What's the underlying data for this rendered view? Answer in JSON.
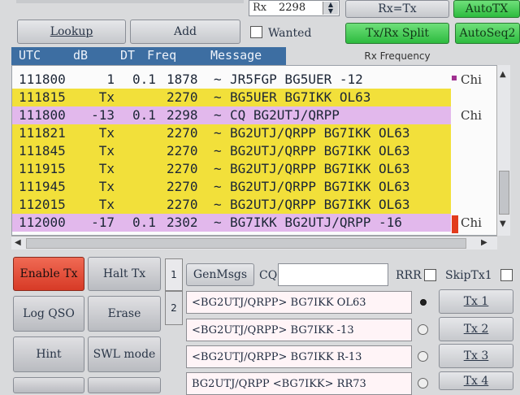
{
  "top": {
    "rx_label": "Rx",
    "rx_value": "2298",
    "rx_eq_tx_label": "Rx=Tx",
    "auto_tx_label": "AutoTX",
    "lookup_label": "Lookup",
    "add_label": "Add",
    "wanted_label": "Wanted",
    "txrx_split_label": "Tx/Rx Split",
    "auto_seq_label": "AutoSeq2"
  },
  "table": {
    "headers": {
      "utc": "UTC",
      "db": "dB",
      "dt": "DT",
      "freq": "Freq",
      "message": "Message"
    },
    "rx_frequency_label": "Rx Frequency",
    "rows": [
      {
        "utc": "111800",
        "db": "1",
        "dt": "0.1",
        "freq": "1878",
        "sep": "~",
        "msg": "JR5FGP BG5UER -12",
        "style": "plain",
        "side": "Chi"
      },
      {
        "utc": "111815",
        "db": "Tx",
        "dt": "",
        "freq": "2270",
        "sep": "~",
        "msg": "BG5UER BG7IKK OL63",
        "style": "yellow",
        "side": ""
      },
      {
        "utc": "111800",
        "db": "-13",
        "dt": "0.1",
        "freq": "2298",
        "sep": "~",
        "msg": "CQ BG2UTJ/QRPP",
        "style": "purple",
        "side": "Chi"
      },
      {
        "utc": "111821",
        "db": "Tx",
        "dt": "",
        "freq": "2270",
        "sep": "~",
        "msg": "BG2UTJ/QRPP BG7IKK OL63",
        "style": "yellow",
        "side": ""
      },
      {
        "utc": "111845",
        "db": "Tx",
        "dt": "",
        "freq": "2270",
        "sep": "~",
        "msg": "BG2UTJ/QRPP BG7IKK OL63",
        "style": "yellow",
        "side": ""
      },
      {
        "utc": "111915",
        "db": "Tx",
        "dt": "",
        "freq": "2270",
        "sep": "~",
        "msg": "BG2UTJ/QRPP BG7IKK OL63",
        "style": "yellow",
        "side": ""
      },
      {
        "utc": "111945",
        "db": "Tx",
        "dt": "",
        "freq": "2270",
        "sep": "~",
        "msg": "BG2UTJ/QRPP BG7IKK OL63",
        "style": "yellow",
        "side": ""
      },
      {
        "utc": "112015",
        "db": "Tx",
        "dt": "",
        "freq": "2270",
        "sep": "~",
        "msg": "BG2UTJ/QRPP BG7IKK OL63",
        "style": "yellow",
        "side": ""
      },
      {
        "utc": "112000",
        "db": "-17",
        "dt": "0.1",
        "freq": "2302",
        "sep": "~",
        "msg": "BG7IKK BG2UTJ/QRPP -16",
        "style": "purple",
        "side": "Chi"
      }
    ]
  },
  "left_buttons": {
    "enable_tx": "Enable Tx",
    "halt_tx": "Halt Tx",
    "log_qso": "Log QSO",
    "erase": "Erase",
    "hint": "Hint",
    "swl_mode": "SWL mode"
  },
  "tx_panel": {
    "tab1": "1",
    "tab2": "2",
    "genmsgs_label": "GenMsgs",
    "cq_label": "CQ",
    "cq_value": "",
    "rrr_label": "RRR",
    "skiptx1_label": "SkipTx1",
    "messages": [
      {
        "text": "<BG2UTJ/QRPP> BG7IKK OL63",
        "button": "Tx 1",
        "selected": true
      },
      {
        "text": "<BG2UTJ/QRPP> BG7IKK -13",
        "button": "Tx 2",
        "selected": false
      },
      {
        "text": "<BG2UTJ/QRPP> BG7IKK R-13",
        "button": "Tx 3",
        "selected": false
      },
      {
        "text": "BG2UTJ/QRPP <BG7IKK> RR73",
        "button": "Tx 4",
        "selected": false
      }
    ]
  },
  "colors": {
    "header_bg": "#3d6ea2",
    "tx_row": "#f2e03a",
    "rx_highlight": "#e2b8ec",
    "enable_tx": "#e0462f",
    "green_button": "#2dbb3f"
  }
}
